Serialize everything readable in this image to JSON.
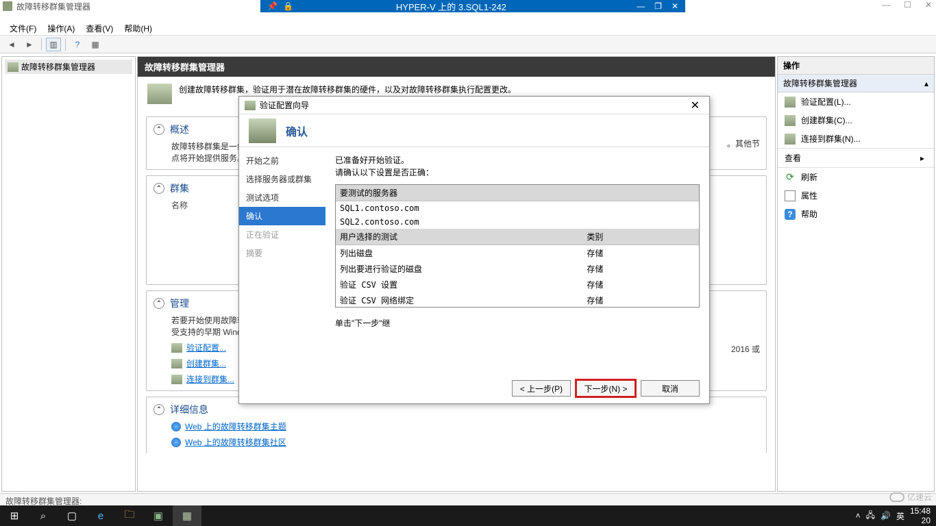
{
  "vm": {
    "title": "HYPER-V 上的 3.SQL1-242"
  },
  "outer_window": {
    "min": "—",
    "max": "☐",
    "close": "✕"
  },
  "app": {
    "title": "故障转移群集管理器",
    "menu": {
      "file": "文件(F)",
      "action": "操作(A)",
      "view": "查看(V)",
      "help": "帮助(H)"
    }
  },
  "tree": {
    "root": "故障转移群集管理器"
  },
  "center": {
    "header": "故障转移群集管理器",
    "intro": "创建故障转移群集，验证用于潜在故障转移群集的硬件，以及对故障转移群集执行配置更改。",
    "overview_title": "概述",
    "overview_body1": "故障转移群集是一组相互",
    "overview_body2": "点将开始提供服务。此过",
    "clusters_title": "群集",
    "clusters_name": "名称",
    "mgmt_title": "管理",
    "mgmt_body1": "若要开始使用故障转移群",
    "mgmt_body2": "受支持的早期 Windows S",
    "right_hint": "2016 或",
    "other_hint": "。其他节",
    "link_validate": "验证配置...",
    "link_create": "创建群集...",
    "link_connect": "连接到群集...",
    "details_title": "详细信息",
    "link_web_topics": "Web 上的故障转移群集主题",
    "link_web_community": "Web 上的故障转移群集社区"
  },
  "actions": {
    "header": "操作",
    "subheader": "故障转移群集管理器",
    "validate": "验证配置(L)...",
    "create": "创建群集(C)...",
    "connect": "连接到群集(N)...",
    "view": "查看",
    "refresh": "刷新",
    "properties": "属性",
    "help": "帮助"
  },
  "wizard": {
    "title": "验证配置向导",
    "header": "确认",
    "nav": {
      "before": "开始之前",
      "select": "选择服务器或群集",
      "tests": "测试选项",
      "confirm": "确认",
      "validating": "正在验证",
      "summary": "摘要"
    },
    "instr1": "已准备好开始验证。",
    "instr2": "请确认以下设置是否正确：",
    "th_servers": "要测试的服务器",
    "server1": "SQL1.contoso.com",
    "server2": "SQL2.contoso.com",
    "th_tests": "用户选择的测试",
    "th_category": "类别",
    "rows": [
      {
        "test": "列出磁盘",
        "cat": "存储"
      },
      {
        "test": "列出要进行验证的磁盘",
        "cat": "存储"
      },
      {
        "test": "验证 CSV 设置",
        "cat": "存储"
      },
      {
        "test": "验证 CSV 网络绑定",
        "cat": "存储"
      }
    ],
    "hint": "单击\"下一步\"继",
    "btn_prev": "< 上一步(P)",
    "btn_next": "下一步(N) >",
    "btn_cancel": "取消"
  },
  "status": "故障转移群集管理器:",
  "taskbar": {
    "ime": "英",
    "time": "15:48",
    "date_partial": "20"
  },
  "watermark": "亿速云"
}
